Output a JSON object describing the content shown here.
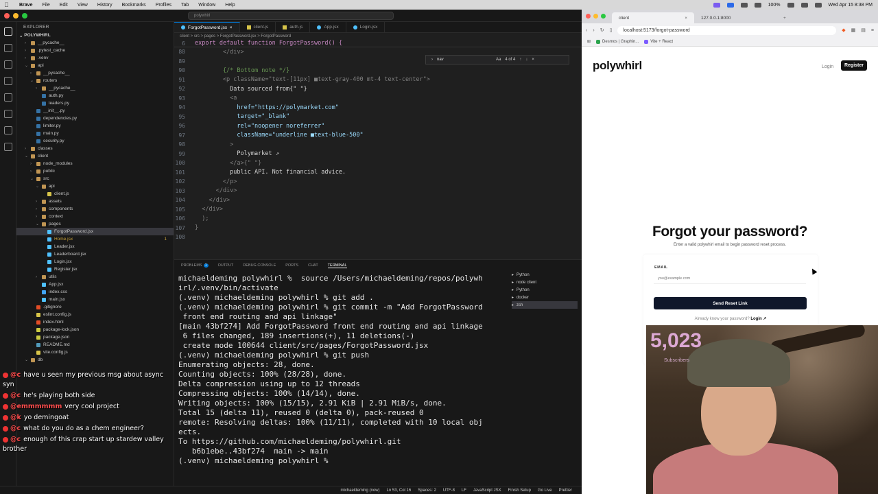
{
  "menubar": {
    "app": "Brave",
    "items": [
      "File",
      "Edit",
      "View",
      "History",
      "Bookmarks",
      "Profiles",
      "Tab",
      "Window",
      "Help"
    ],
    "clock": "Wed Apr 15  8:38 PM",
    "battery": "100%"
  },
  "vscode": {
    "search_placeholder": "polywhirl",
    "explorer_header": "EXPLORER",
    "project": "POLYWHIRL",
    "tree": [
      {
        "label": "__pycache__",
        "indent": 1,
        "type": "folder",
        "open": false
      },
      {
        "label": ".pytest_cache",
        "indent": 1,
        "type": "folder",
        "open": false
      },
      {
        "label": ".venv",
        "indent": 1,
        "type": "folder",
        "open": false
      },
      {
        "label": "api",
        "indent": 1,
        "type": "folder",
        "open": true
      },
      {
        "label": "__pycache__",
        "indent": 2,
        "type": "folder",
        "open": false
      },
      {
        "label": "routers",
        "indent": 2,
        "type": "folder",
        "open": true
      },
      {
        "label": "__pycache__",
        "indent": 3,
        "type": "folder",
        "open": false
      },
      {
        "label": "auth.py",
        "indent": 3,
        "type": "py"
      },
      {
        "label": "leaders.py",
        "indent": 3,
        "type": "py"
      },
      {
        "label": "__init__.py",
        "indent": 2,
        "type": "py"
      },
      {
        "label": "dependencies.py",
        "indent": 2,
        "type": "py"
      },
      {
        "label": "limiter.py",
        "indent": 2,
        "type": "py"
      },
      {
        "label": "main.py",
        "indent": 2,
        "type": "py"
      },
      {
        "label": "security.py",
        "indent": 2,
        "type": "py"
      },
      {
        "label": "classes",
        "indent": 1,
        "type": "folder",
        "open": false
      },
      {
        "label": "client",
        "indent": 1,
        "type": "folder",
        "open": true
      },
      {
        "label": "node_modules",
        "indent": 2,
        "type": "folder",
        "open": false
      },
      {
        "label": "public",
        "indent": 2,
        "type": "folder",
        "open": false
      },
      {
        "label": "src",
        "indent": 2,
        "type": "folder",
        "open": true
      },
      {
        "label": "api",
        "indent": 3,
        "type": "folder",
        "open": true
      },
      {
        "label": "client.js",
        "indent": 4,
        "type": "js"
      },
      {
        "label": "assets",
        "indent": 3,
        "type": "folder",
        "open": false
      },
      {
        "label": "components",
        "indent": 3,
        "type": "folder",
        "open": false
      },
      {
        "label": "context",
        "indent": 3,
        "type": "folder",
        "open": false
      },
      {
        "label": "pages",
        "indent": 3,
        "type": "folder",
        "open": true
      },
      {
        "label": "ForgotPassword.jsx",
        "indent": 4,
        "type": "jsx",
        "selected": true
      },
      {
        "label": "Home.jsx",
        "indent": 4,
        "type": "jsx",
        "badge": "1"
      },
      {
        "label": "Leader.jsx",
        "indent": 4,
        "type": "jsx"
      },
      {
        "label": "Leaderboard.jsx",
        "indent": 4,
        "type": "jsx"
      },
      {
        "label": "Login.jsx",
        "indent": 4,
        "type": "jsx"
      },
      {
        "label": "Register.jsx",
        "indent": 4,
        "type": "jsx"
      },
      {
        "label": "utils",
        "indent": 3,
        "type": "folder",
        "open": false
      },
      {
        "label": "App.jsx",
        "indent": 3,
        "type": "jsx"
      },
      {
        "label": "index.css",
        "indent": 3,
        "type": "css"
      },
      {
        "label": "main.jsx",
        "indent": 3,
        "type": "jsx"
      },
      {
        "label": ".gitignore",
        "indent": 2,
        "type": "git"
      },
      {
        "label": "eslint.config.js",
        "indent": 2,
        "type": "js"
      },
      {
        "label": "index.html",
        "indent": 2,
        "type": "html"
      },
      {
        "label": "package-lock.json",
        "indent": 2,
        "type": "json"
      },
      {
        "label": "package.json",
        "indent": 2,
        "type": "json"
      },
      {
        "label": "README.md",
        "indent": 2,
        "type": "md"
      },
      {
        "label": "vite.config.js",
        "indent": 2,
        "type": "js"
      },
      {
        "label": "db",
        "indent": 1,
        "type": "folder",
        "open": true
      }
    ],
    "tabs": [
      {
        "label": "ForgotPassword.jsx",
        "kind": "jsx",
        "active": true
      },
      {
        "label": "client.js",
        "kind": "js"
      },
      {
        "label": "auth.js",
        "kind": "js"
      },
      {
        "label": "App.jsx",
        "kind": "jsx"
      },
      {
        "label": "Login.jsx",
        "kind": "jsx"
      }
    ],
    "breadcrumb": "client > src > pages > ForgotPassword.jsx > ForgotPassword",
    "find": {
      "query": "nav",
      "match": "4 of 4",
      "aa": "Aa"
    },
    "sticky": {
      "num": "6",
      "text": "export default function ForgotPassword() {"
    },
    "code": [
      {
        "num": "88",
        "text": "        </div>"
      },
      {
        "num": "89",
        "text": ""
      },
      {
        "num": "90",
        "text": "        {/* Bottom note */}"
      },
      {
        "num": "91",
        "text": "        <p className=\"text-[11px] ■text-gray-400 mt-4 text-center\">"
      },
      {
        "num": "92",
        "text": "          Data sourced from{\" \"}"
      },
      {
        "num": "93",
        "text": "          <a"
      },
      {
        "num": "94",
        "text": "            href=\"https://polymarket.com\""
      },
      {
        "num": "95",
        "text": "            target=\"_blank\""
      },
      {
        "num": "96",
        "text": "            rel=\"noopener noreferrer\""
      },
      {
        "num": "97",
        "text": "            className=\"underline ■text-blue-500\""
      },
      {
        "num": "98",
        "text": "          >"
      },
      {
        "num": "99",
        "text": "            Polymarket ↗"
      },
      {
        "num": "100",
        "text": "          </a>{\" \"}"
      },
      {
        "num": "101",
        "text": "          public API. Not financial advice."
      },
      {
        "num": "102",
        "text": "        </p>"
      },
      {
        "num": "103",
        "text": "      </div>"
      },
      {
        "num": "104",
        "text": "    </div>"
      },
      {
        "num": "105",
        "text": "  </div>"
      },
      {
        "num": "106",
        "text": "  );"
      },
      {
        "num": "107",
        "text": "}"
      },
      {
        "num": "108",
        "text": ""
      }
    ],
    "panel_tabs": [
      "PROBLEMS",
      "OUTPUT",
      "DEBUG CONSOLE",
      "PORTS",
      "CHAT",
      "TERMINAL"
    ],
    "problems_count": "1",
    "terminal_lines": [
      "michaeldeming polywhirl %  source /Users/michaeldeming/repos/polywh",
      "irl/.venv/bin/activate",
      "(.venv) michaeldeming polywhirl % git add .",
      "(.venv) michaeldeming polywhirl % git commit -m \"Add ForgotPassword",
      " front end routing and api linkage\"",
      "[main 43bf274] Add ForgotPassword front end routing and api linkage",
      " 6 files changed, 189 insertions(+), 11 deletions(-)",
      " create mode 100644 client/src/pages/ForgotPassword.jsx",
      "(.venv) michaeldeming polywhirl % git push",
      "Enumerating objects: 28, done.",
      "Counting objects: 100% (28/28), done.",
      "Delta compression using up to 12 threads",
      "Compressing objects: 100% (14/14), done.",
      "Writing objects: 100% (15/15), 2.91 KiB | 2.91 MiB/s, done.",
      "Total 15 (delta 11), reused 0 (delta 0), pack-reused 0",
      "remote: Resolving deltas: 100% (11/11), completed with 10 local obj",
      "ects.",
      "To https://github.com/michaeldeming/polywhirl.git",
      "   b6b1ebe..43bf274  main -> main",
      "(.venv) michaeldeming polywhirl % "
    ],
    "terminals": [
      "Python",
      "node  client",
      "Python",
      "docker",
      "zsh"
    ],
    "status": [
      "michaeldeming (now)",
      "Ln 53, Col 16",
      "Spaces: 2",
      "UTF-8",
      "LF",
      "JavaScript JSX",
      "Finish Setup",
      "Go Live",
      "Prettier"
    ]
  },
  "chat": [
    {
      "user": "@c",
      "text": "have u seen my previous msg about async syn"
    },
    {
      "user": "@c",
      "text": "he's playing both side"
    },
    {
      "user": "@emmmmmm",
      "text": "very cool project"
    },
    {
      "user": "@k",
      "text": "yo demingoat"
    },
    {
      "user": "@c",
      "text": "what do you do as a chem engineer?"
    },
    {
      "user": "@c",
      "text": "enough of this crap start up stardew valley brother"
    }
  ],
  "browser": {
    "tabs": [
      {
        "label": "client",
        "active": true
      },
      {
        "label": "127.0.0.1:8000"
      }
    ],
    "url": "localhost:5173/forgot-password",
    "bookmarks": [
      "Desmos | Graphin...",
      "Vite + React"
    ],
    "page": {
      "logo": "polywhirl",
      "nav_login": "Login",
      "nav_register": "Register",
      "title": "Forgot your password?",
      "subtitle": "Enter a valid polywhirl email to begin password reset process.",
      "email_label": "EMAIL",
      "email_placeholder": "you@example.com",
      "send_button": "Send Reset Link",
      "already": "Already know your password?",
      "login_link": "Login ↗"
    }
  },
  "webcam": {
    "count": "5,023",
    "label": "Subscribers"
  }
}
